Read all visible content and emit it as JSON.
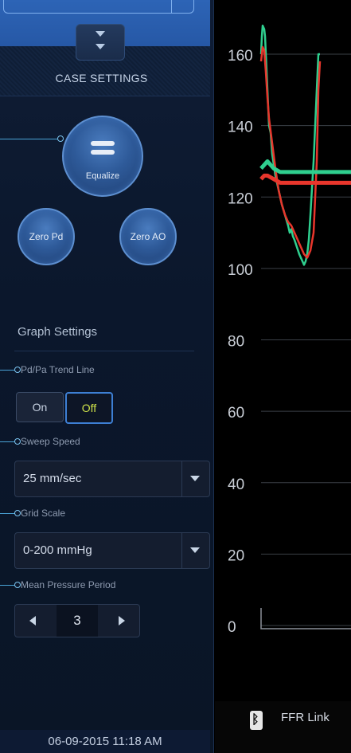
{
  "sidebar": {
    "case_settings_title": "CASE SETTINGS",
    "equalize_label": "Equalize",
    "zero_pd_label": "Zero Pd",
    "zero_ao_label": "Zero AO",
    "graph_settings_title": "Graph Settings",
    "trend_line": {
      "label": "Pd/Pa Trend Line",
      "on_label": "On",
      "off_label": "Off",
      "selected": "Off"
    },
    "sweep_speed": {
      "label": "Sweep Speed",
      "value": "25 mm/sec"
    },
    "grid_scale": {
      "label": "Grid Scale",
      "value": "0-200 mmHg"
    },
    "mean_pressure_period": {
      "label": "Mean Pressure Period",
      "value": "3"
    },
    "datetime": "06-09-2015 11:18 AM"
  },
  "footer": {
    "link_label": "FFR Link",
    "icon": "bluetooth-icon"
  },
  "colors": {
    "accent_blue": "#3d7fd4",
    "pd_trace": "#2fcf8f",
    "pa_trace": "#e8362c",
    "off_text": "#cfe24a"
  },
  "chart_data": {
    "type": "line",
    "ylim": [
      0,
      170
    ],
    "y_ticks": [
      "160",
      "140",
      "120",
      "100",
      "80",
      "60",
      "40",
      "20",
      "0"
    ],
    "series": [
      {
        "x": [
          0,
          1,
          2,
          4,
          5,
          6,
          8,
          10,
          12,
          14,
          18,
          22,
          26,
          30,
          34,
          36,
          38,
          40,
          42,
          45,
          48,
          50,
          52,
          54,
          56,
          58,
          60,
          62,
          66,
          70,
          72,
          74
        ],
        "values": [
          160,
          165,
          168,
          167,
          165,
          160,
          150,
          140,
          138,
          132,
          126,
          122,
          118,
          115,
          112,
          110,
          111,
          109,
          108,
          106,
          104,
          103,
          102,
          101,
          102,
          104,
          108,
          115,
          130,
          150,
          160,
          160
        ]
      },
      {
        "x": [
          0,
          2,
          4,
          6,
          8,
          10,
          14,
          18,
          22,
          26,
          30,
          34,
          38,
          42,
          46,
          50,
          54,
          58,
          62,
          66,
          70,
          72,
          74
        ],
        "values": [
          158,
          162,
          161,
          155,
          148,
          142,
          135,
          128,
          122,
          118,
          115,
          113,
          112,
          110,
          108,
          106,
          104,
          103,
          105,
          110,
          130,
          150,
          158
        ]
      },
      {
        "x": [
          0,
          4,
          8,
          16,
          24,
          40,
          60,
          80,
          100,
          130,
          171
        ],
        "values": [
          128,
          129,
          130,
          128,
          127,
          127,
          127,
          127,
          127,
          127,
          127
        ]
      },
      {
        "x": [
          0,
          4,
          8,
          16,
          24,
          40,
          60,
          80,
          100,
          130,
          171
        ],
        "values": [
          125,
          126,
          126,
          125,
          124,
          124,
          124,
          124,
          124,
          124,
          124
        ]
      }
    ],
    "grid": true
  }
}
